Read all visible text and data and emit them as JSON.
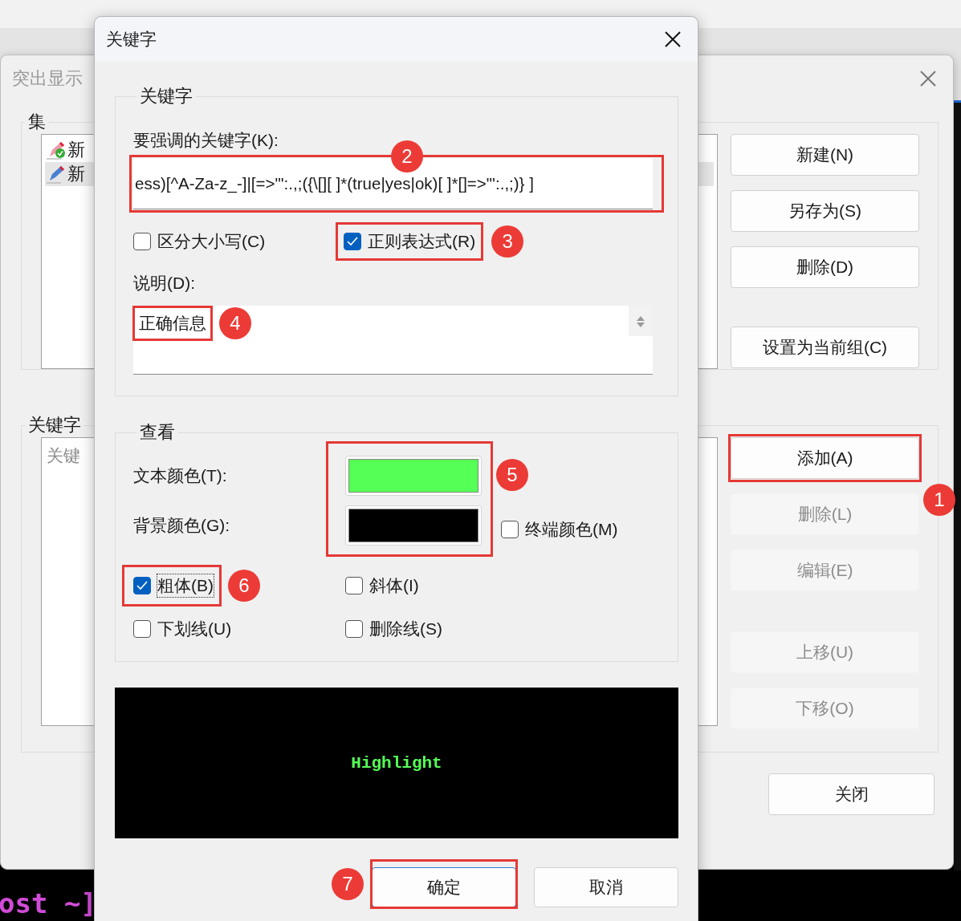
{
  "background_window": {
    "title": "突出显示",
    "sets_group": {
      "label": "集",
      "items": [
        {
          "text": "新",
          "selected": false
        },
        {
          "text": "新",
          "selected": true
        }
      ],
      "buttons": [
        {
          "label": "新建(N)",
          "disabled": false
        },
        {
          "label": "另存为(S)",
          "disabled": false
        },
        {
          "label": "删除(D)",
          "disabled": false
        },
        {
          "label": "设置为当前组(C)",
          "disabled": false
        }
      ]
    },
    "keywords_group": {
      "label": "关键字",
      "list_text": "关键",
      "buttons": [
        {
          "label": "添加(A)",
          "disabled": false
        },
        {
          "label": "删除(L)",
          "disabled": true
        },
        {
          "label": "编辑(E)",
          "disabled": true
        },
        {
          "label": "上移(U)",
          "disabled": true
        },
        {
          "label": "下移(O)",
          "disabled": true
        }
      ]
    },
    "close_button": "关闭"
  },
  "terminal": {
    "lines": [
      "ost ~]"
    ]
  },
  "dialog": {
    "title": "关键字",
    "keyword_group": {
      "label": "关键字",
      "field_label": "要强调的关键字(K):",
      "value": "ess)[^A-Za-z_-]|[=>\"':.,;({\\[][ ]*(true|yes|ok)[ ]*[]=>\"':.,;)} ]",
      "options": [
        {
          "label": "区分大小写(C)",
          "checked": false
        },
        {
          "label": "正则表达式(R)",
          "checked": true
        }
      ],
      "description_label": "说明(D):",
      "description": "正确信息"
    },
    "view_group": {
      "label": "查看",
      "text_color": {
        "label": "文本颜色(T):",
        "color": "#55ff55"
      },
      "background_color": {
        "label": "背景颜色(G):",
        "color": "#000000"
      },
      "terminal_color": {
        "label": "终端颜色(M)",
        "checked": false
      },
      "styles": [
        {
          "kind": "bold",
          "label": "粗体(B)",
          "checked": true,
          "focused": true
        },
        {
          "kind": "italic",
          "label": "斜体(I)",
          "checked": false,
          "focused": false
        },
        {
          "kind": "underline",
          "label": "下划线(U)",
          "checked": false,
          "focused": false
        },
        {
          "kind": "strike",
          "label": "删除线(S)",
          "checked": false,
          "focused": false
        }
      ]
    },
    "preview_text": "Highlight",
    "buttons": [
      {
        "label": "确定",
        "default": true
      },
      {
        "label": "取消",
        "default": false
      }
    ]
  },
  "annotations": [
    {
      "number": "1"
    },
    {
      "number": "2"
    },
    {
      "number": "3"
    },
    {
      "number": "4"
    },
    {
      "number": "5"
    },
    {
      "number": "6"
    },
    {
      "number": "7"
    }
  ]
}
